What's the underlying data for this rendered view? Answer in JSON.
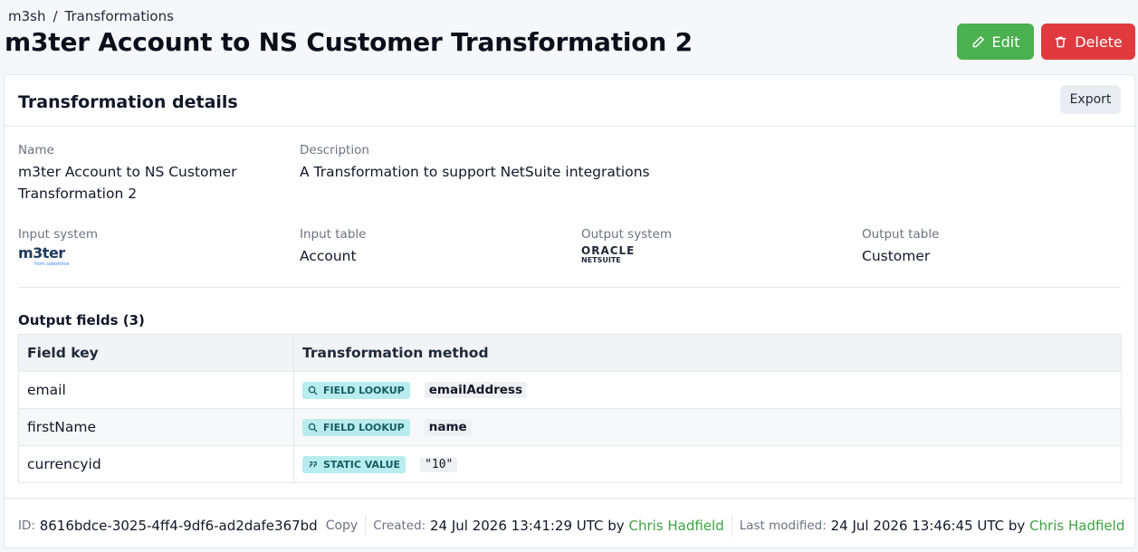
{
  "breadcrumb": {
    "root": "m3sh",
    "separator": "/",
    "current": "Transformations"
  },
  "page": {
    "title": "m3ter Account to NS Customer Transformation 2"
  },
  "actions": {
    "edit": "Edit",
    "delete": "Delete"
  },
  "colors": {
    "edit": "#4bb04f",
    "delete": "#e03a3e",
    "link": "#3fa344",
    "badge_bg": "#b9ecee"
  },
  "details": {
    "title": "Transformation details",
    "export": "Export",
    "name_label": "Name",
    "name_line1": "m3ter Account to NS Customer",
    "name_line2": "Transformation 2",
    "description_label": "Description",
    "description": "A Transformation to support NetSuite integrations",
    "input_system_label": "Input system",
    "input_system_logo": "m3ter",
    "input_system_logo_sub": "from salesforce",
    "input_table_label": "Input table",
    "input_table": "Account",
    "output_system_label": "Output system",
    "output_system_logo_top": "ORACLE",
    "output_system_logo_bottom": "NETSUITE",
    "output_table_label": "Output table",
    "output_table": "Customer"
  },
  "output_fields": {
    "title": "Output fields (3)",
    "columns": [
      "Field key",
      "Transformation method"
    ],
    "rows": [
      {
        "key": "email",
        "method": "FIELD LOOKUP",
        "method_icon": "search-icon",
        "value": "emailAddress"
      },
      {
        "key": "firstName",
        "method": "FIELD LOOKUP",
        "method_icon": "search-icon",
        "value": "name"
      },
      {
        "key": "currencyid",
        "method": "STATIC VALUE",
        "method_icon": "quote-icon",
        "value": "\"10\""
      }
    ]
  },
  "footer": {
    "id_label": "ID:",
    "id": "8616bdce-3025-4ff4-9df6-ad2dafe367bd",
    "copy": "Copy",
    "created_label": "Created:",
    "created": "24 Jul 2026 13:41:29 UTC by",
    "created_by": "Chris Hadfield",
    "modified_label": "Last modified:",
    "modified": "24 Jul 2026 13:46:45 UTC by",
    "modified_by": "Chris Hadfield"
  }
}
